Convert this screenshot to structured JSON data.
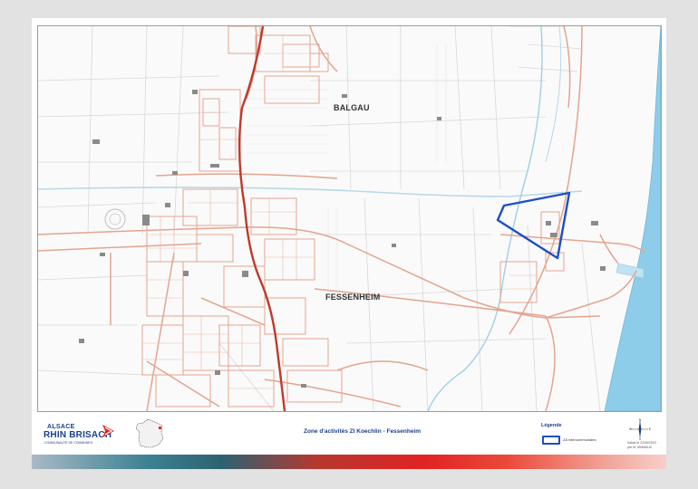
{
  "map": {
    "places": {
      "balgau": "BALGAU",
      "fessenheim": "FESSENHEIM"
    },
    "zone_outline_color": "#1c4fc4",
    "road_color": "#e4a48e",
    "main_road_color": "#c0392b",
    "water_color": "#9fcfe6",
    "river_color": "#8ecde9"
  },
  "footer": {
    "logo_top": "ALSACE",
    "logo_main": "RHIN BRISACH",
    "logo_sub": "COMMUNAUTÉ DE COMMUNES",
    "title": "Zone d'activités ZI Koechlin - Fessenheim",
    "legend_title": "Légende",
    "legend_label": "ZA intercommunales",
    "credits_line1": "Saisie le 22/06/2023",
    "credits_line2": "par M. SIMMAUX",
    "compass": {
      "n": "N",
      "s": "S",
      "e": "E",
      "w": "W"
    }
  }
}
